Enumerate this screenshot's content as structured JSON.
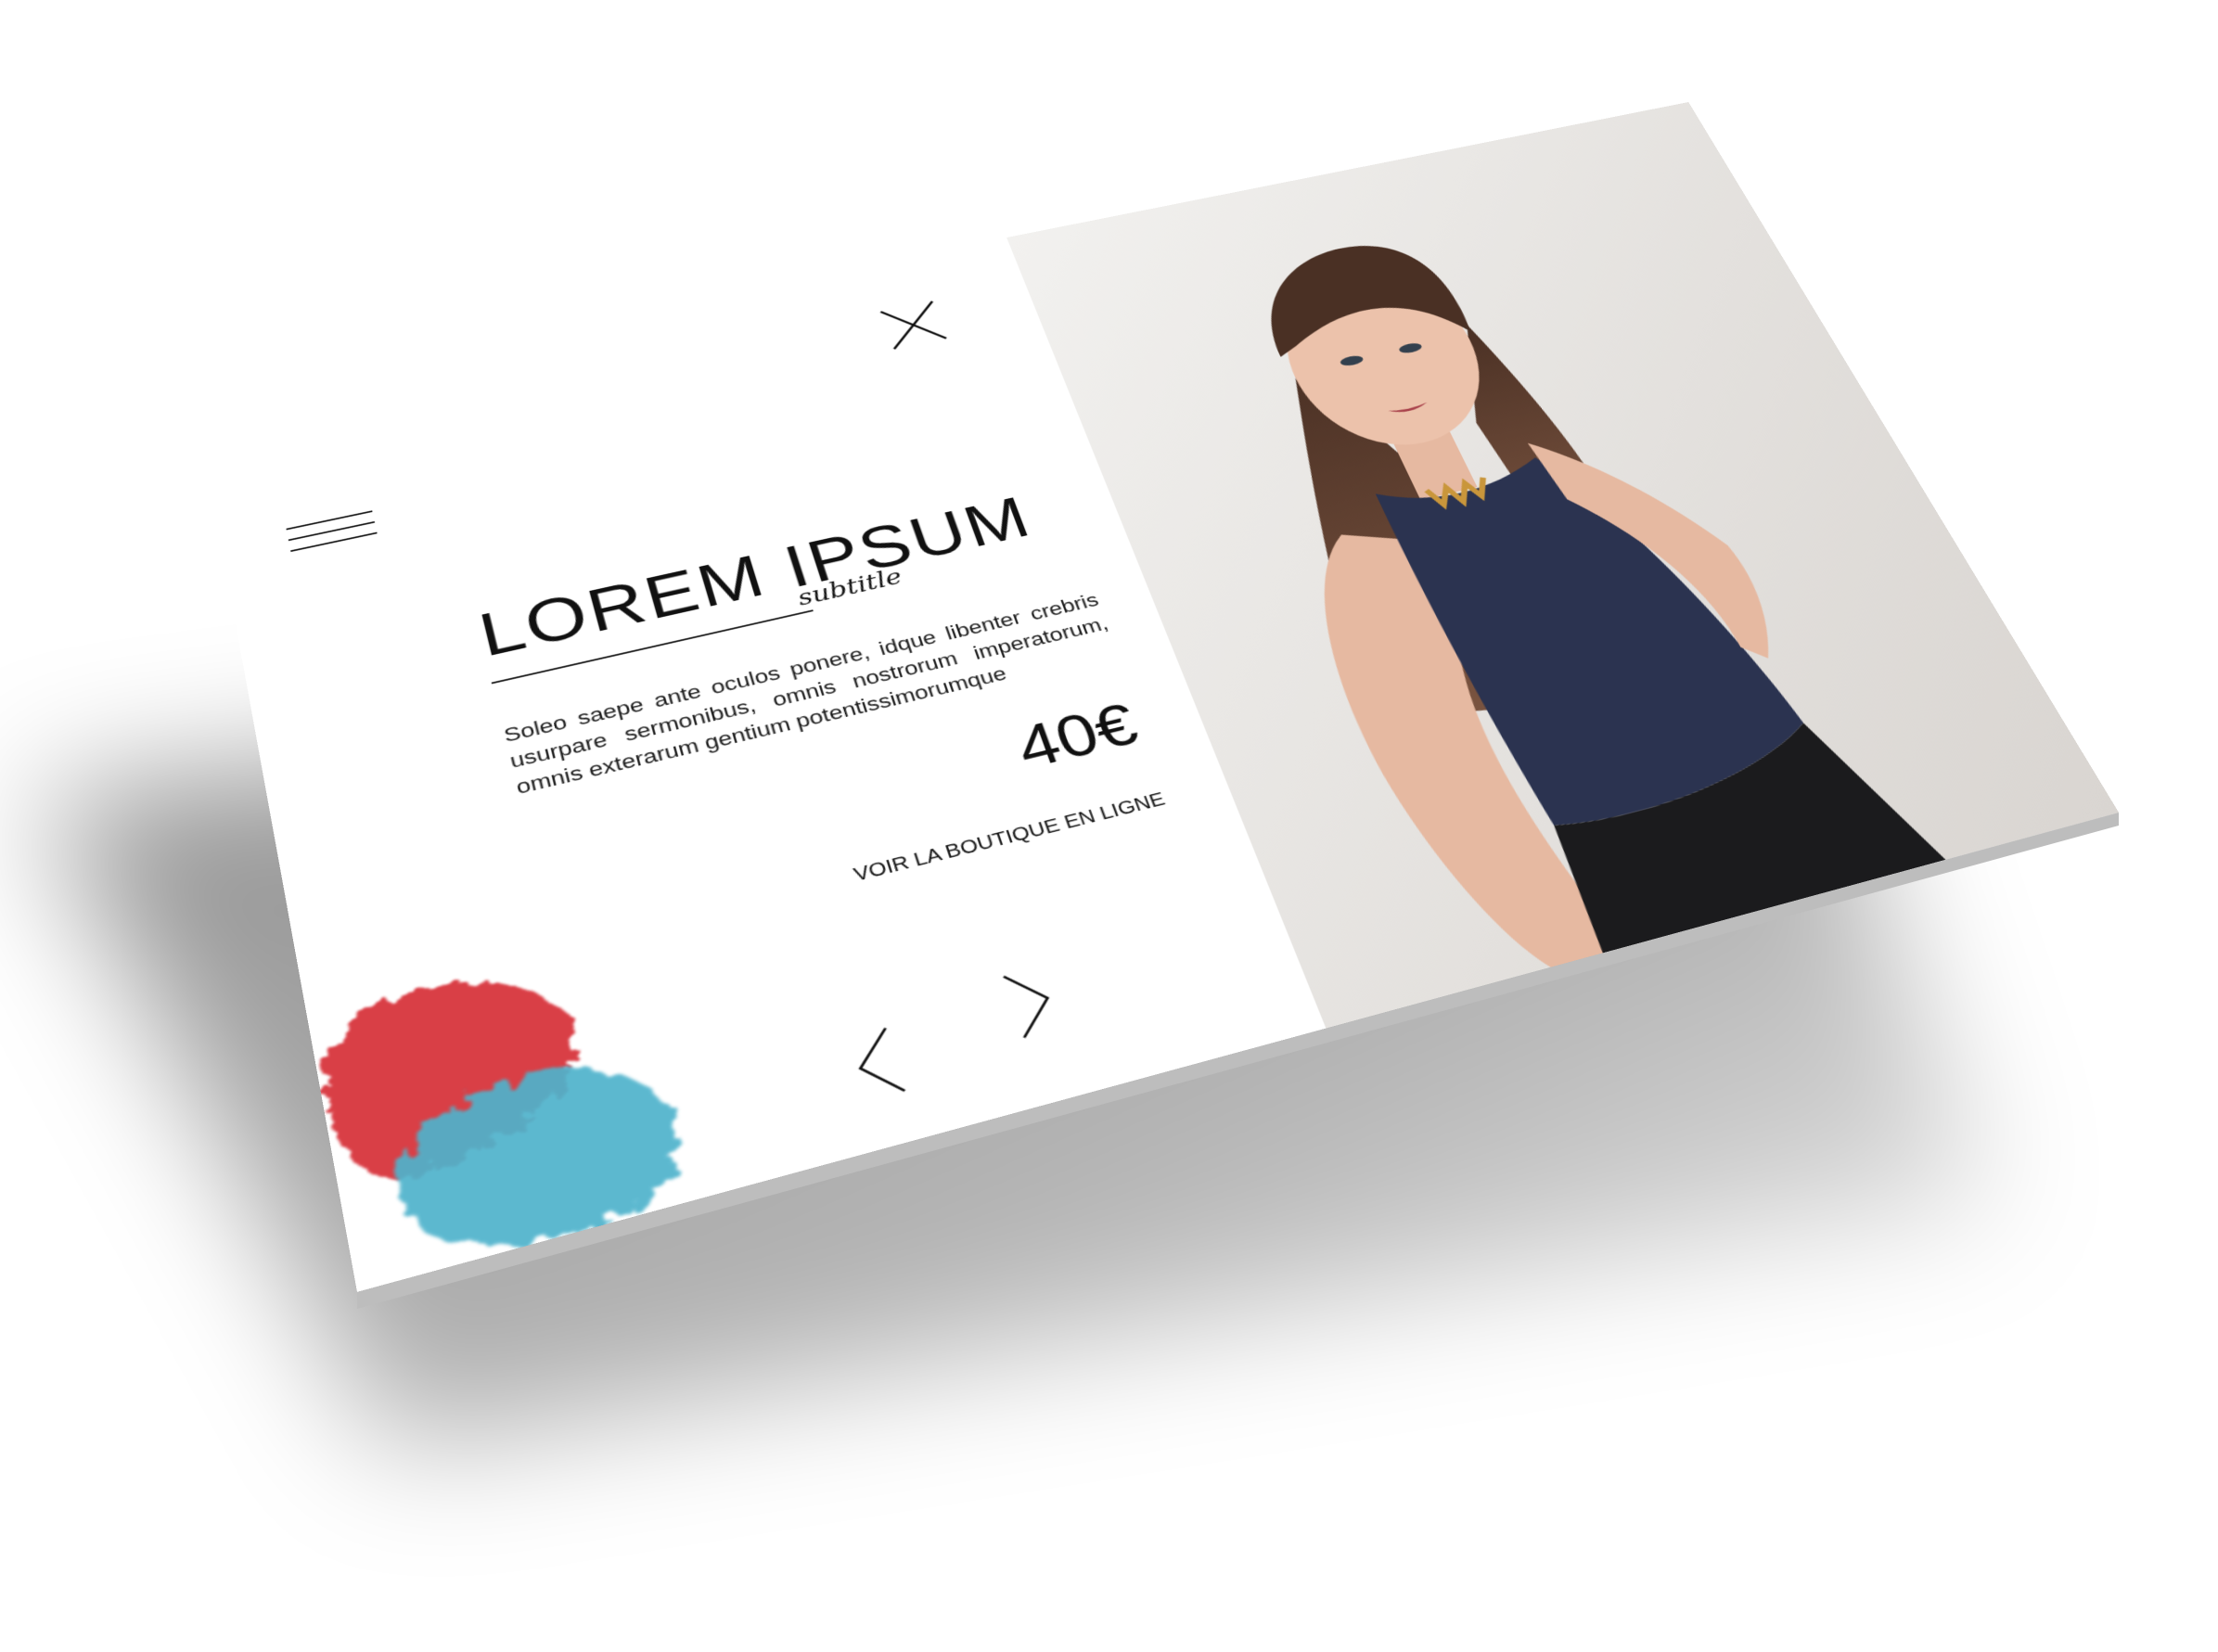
{
  "product": {
    "title": "LOREM IPSUM",
    "subtitle": "subtitle",
    "description": "Soleo saepe ante oculos ponere, idque libenter crebris usurpare sermonibus, omnis nostrorum imperatorum, omnis exterarum gentium potentissimorumque",
    "price": "40€",
    "shop_link": "VOIR LA BOUTIQUE EN LIGNE"
  },
  "icons": {
    "menu": "hamburger-menu-icon",
    "close": "close-icon",
    "prev": "chevron-left-icon",
    "next": "chevron-right-icon"
  },
  "colors": {
    "paint_red": "#d8343c",
    "paint_blue": "#4fb3cc",
    "top_navy": "#2b3350",
    "ink": "#111111"
  }
}
